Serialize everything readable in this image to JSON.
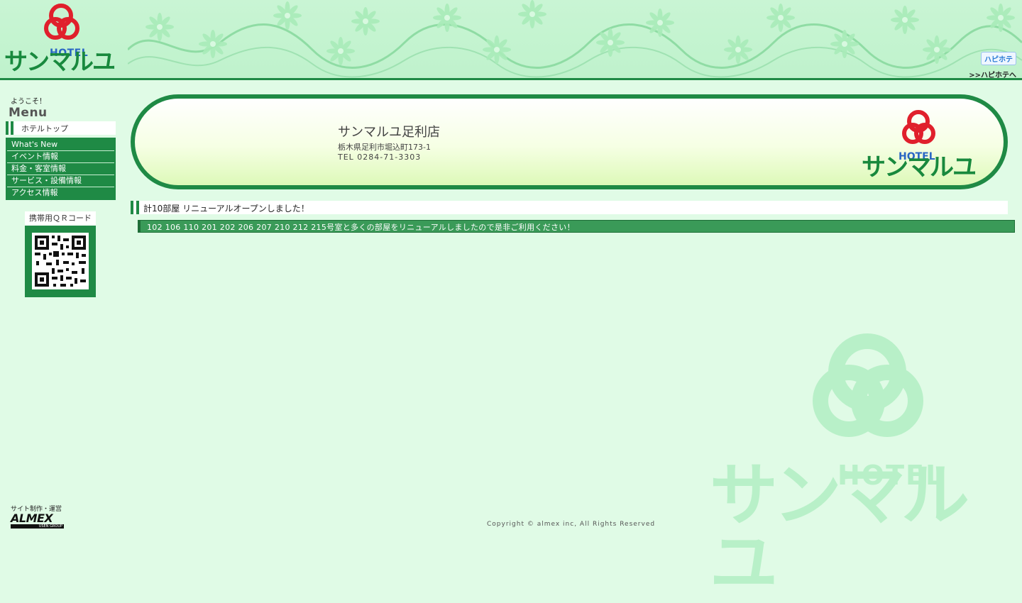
{
  "header": {
    "logo": {
      "small_label": "HOTEL",
      "name": "サンマルユ"
    },
    "happy_link": {
      "badge": "ハピホテ",
      "text": ">>ハピホテへ"
    }
  },
  "sidebar": {
    "welcome": "ようこそ！",
    "menu_title": "Menu",
    "hotel_top": "ホテルトップ",
    "items": [
      {
        "label": "What's New"
      },
      {
        "label": "イベント情報"
      },
      {
        "label": "料金・客室情報"
      },
      {
        "label": "サービス・設備情報"
      },
      {
        "label": "アクセス情報"
      }
    ],
    "qr_label": "携帯用ＱＲコード"
  },
  "banner": {
    "shop_name": "サンマルユ足利店",
    "address": "栃木県足利市堀込町173-1",
    "tel": "TEL 0284-71-3303",
    "logo_small": "HOTEL",
    "logo_name": "サンマルユ"
  },
  "news": {
    "title": "計10部屋 リニューアルオープンしました！",
    "body": "102 106 110 201 202 206 207 210 212 215号室と多くの部屋をリニューアルしましたので是非ご利用ください！"
  },
  "footer": {
    "credit_caption": "サイト制作・運営",
    "credit_logo": "ALMEX",
    "credit_sub": "USEN GROUP",
    "copyright": "Copyright © almex inc, All Rights Reserved",
    "watermark_small": "HOTEL",
    "watermark_name": "サンマルユ"
  },
  "colors": {
    "primary_green": "#1f8a45",
    "logo_red": "#e0202c",
    "logo_blue": "#2966c4",
    "background": "#e0fbe6"
  }
}
